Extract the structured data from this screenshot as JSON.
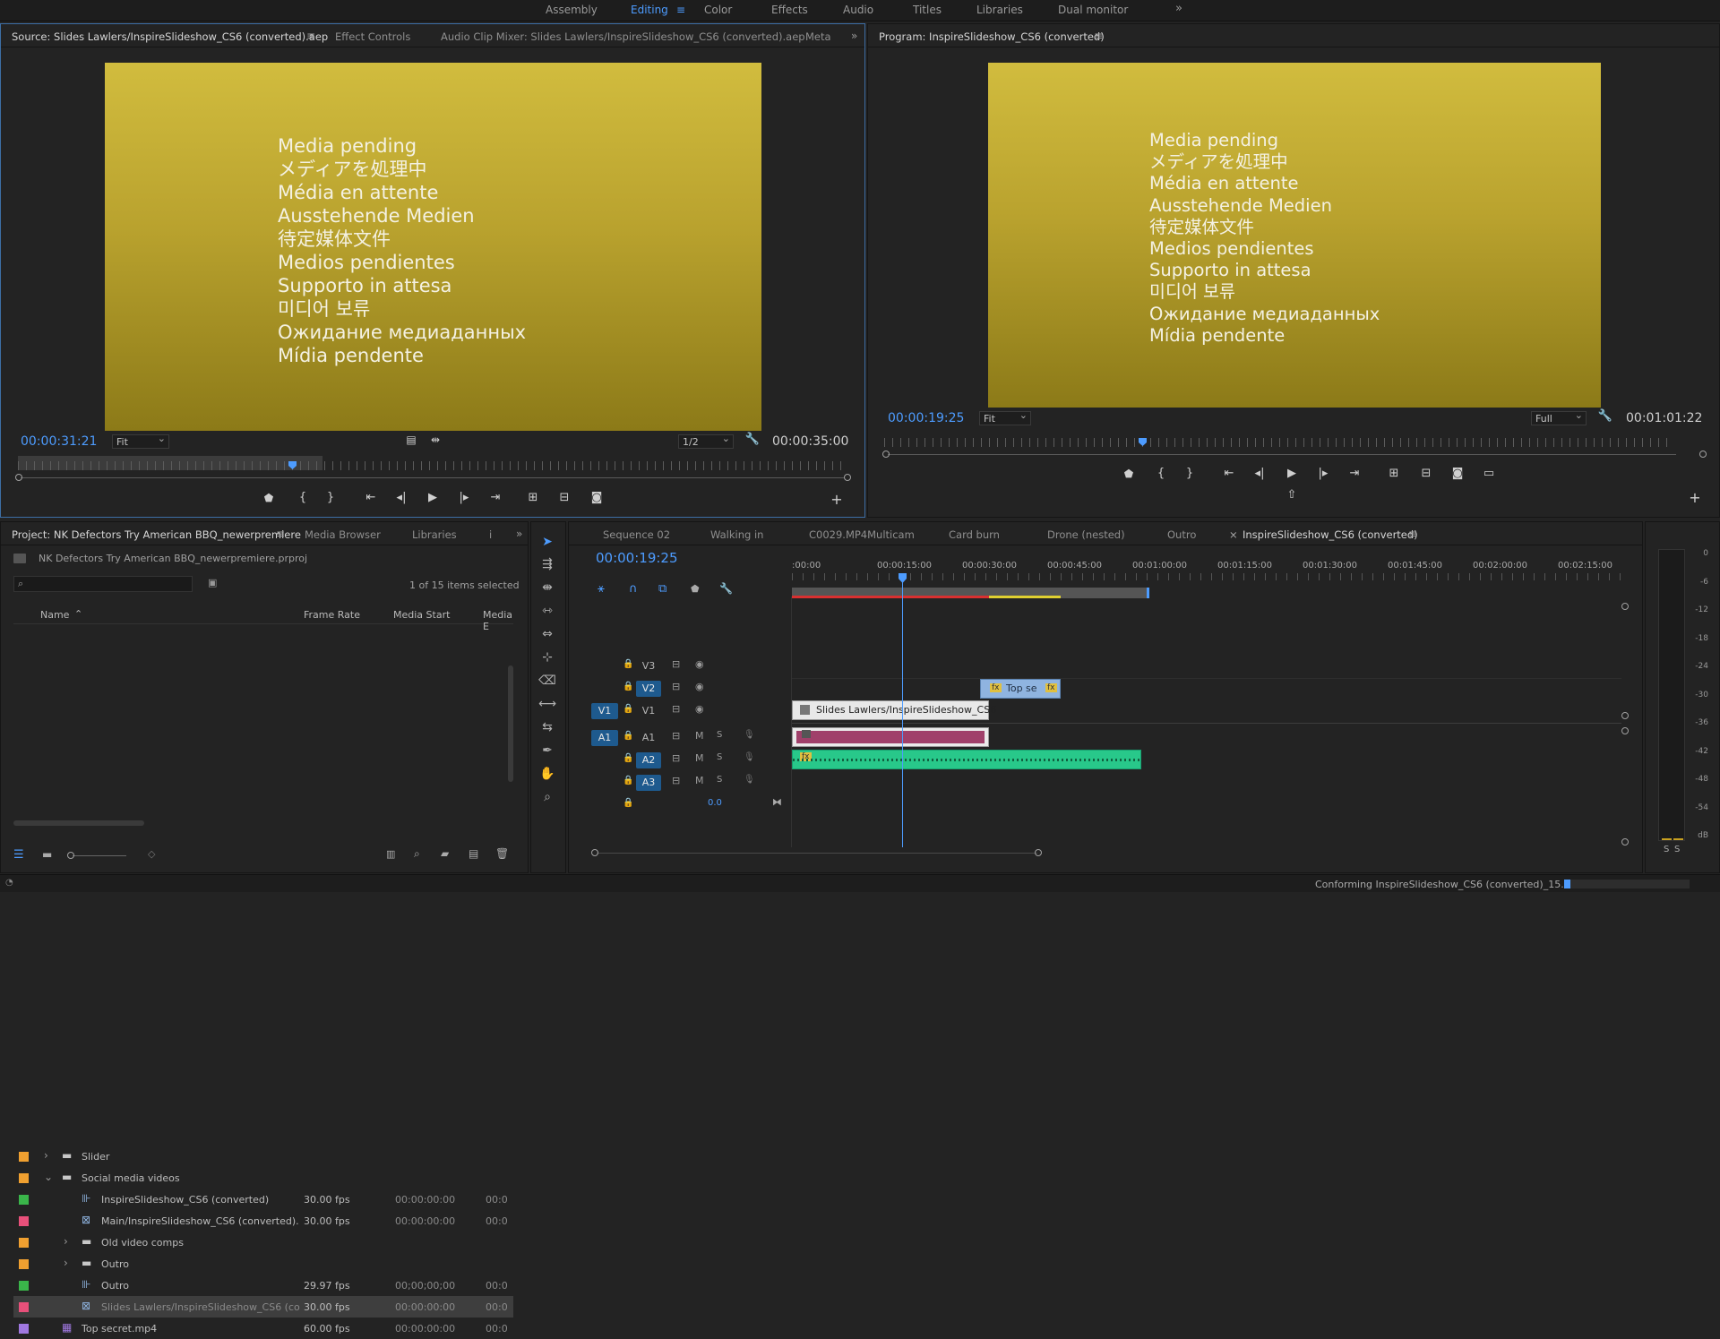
{
  "workspaces": [
    "Assembly",
    "Editing",
    "Color",
    "Effects",
    "Audio",
    "Titles",
    "Libraries",
    "Dual monitor"
  ],
  "workspace_active": "Editing",
  "source": {
    "tabs": [
      "Source: Slides Lawlers/InspireSlideshow_CS6 (converted).aep",
      "Effect Controls",
      "Audio Clip Mixer: Slides Lawlers/InspireSlideshow_CS6 (converted).aep",
      "Meta"
    ],
    "pending": [
      "Media pending",
      "メディアを処理中",
      "Média en attente",
      "Ausstehende Medien",
      "待定媒体文件",
      "Medios pendientes",
      "Supporto in attesa",
      "미디어 보류",
      "Ожидание медиаданных",
      "Mídia pendente"
    ],
    "timecode": "00:00:31:21",
    "fit": "Fit",
    "resolution": "1/2",
    "duration": "00:00:35:00"
  },
  "program": {
    "title": "Program: InspireSlideshow_CS6 (converted)",
    "pending": [
      "Media pending",
      "メディアを処理中",
      "Média en attente",
      "Ausstehende Medien",
      "待定媒体文件",
      "Medios pendientes",
      "Supporto in attesa",
      "미디어 보류",
      "Ожидание медиаданных",
      "Mídia pendente"
    ],
    "timecode": "00:00:19:25",
    "fit": "Fit",
    "resolution": "Full",
    "duration": "00:01:01:22"
  },
  "project": {
    "tabs": [
      "Project: NK Defectors Try American BBQ_newerpremiere",
      "Media Browser",
      "Libraries"
    ],
    "filename": "NK Defectors Try American BBQ_newerpremiere.prproj",
    "selection": "1 of 15 items selected",
    "columns": [
      "Name",
      "Frame Rate",
      "Media Start",
      "Media E"
    ],
    "rows": [
      {
        "name": "Slider",
        "fps": "",
        "start": "",
        "end": "",
        "color": "#f0a030",
        "type": "folder",
        "indent": 0,
        "exp": "›"
      },
      {
        "name": "Social media videos",
        "fps": "",
        "start": "",
        "end": "",
        "color": "#f0a030",
        "type": "folder",
        "indent": 0,
        "exp": "⌄"
      },
      {
        "name": "InspireSlideshow_CS6 (converted)",
        "fps": "30.00 fps",
        "start": "00:00:00:00",
        "end": "00:0",
        "color": "#3ab54a",
        "type": "seq",
        "indent": 1,
        "exp": ""
      },
      {
        "name": "Main/InspireSlideshow_CS6 (converted).",
        "fps": "30.00 fps",
        "start": "00:00:00:00",
        "end": "00:0",
        "color": "#e8507a",
        "type": "clip",
        "indent": 1,
        "exp": ""
      },
      {
        "name": "Old video comps",
        "fps": "",
        "start": "",
        "end": "",
        "color": "#f0a030",
        "type": "folder",
        "indent": 1,
        "exp": "›"
      },
      {
        "name": "Outro",
        "fps": "",
        "start": "",
        "end": "",
        "color": "#f0a030",
        "type": "folder",
        "indent": 1,
        "exp": "›"
      },
      {
        "name": "Outro",
        "fps": "29.97 fps",
        "start": "00;00;00;00",
        "end": "00:0",
        "color": "#3ab54a",
        "type": "seq",
        "indent": 1,
        "exp": ""
      },
      {
        "name": "Slides Lawlers/InspireSlideshow_CS6 (co",
        "fps": "30.00 fps",
        "start": "00:00:00:00",
        "end": "00:0",
        "color": "#e8507a",
        "type": "clip",
        "indent": 1,
        "exp": "",
        "selected": true
      },
      {
        "name": "Top secret.mp4",
        "fps": "60.00 fps",
        "start": "00:00:00:00",
        "end": "00:0",
        "color": "#a078e0",
        "type": "video",
        "indent": 0,
        "exp": ""
      }
    ]
  },
  "timeline": {
    "tabs": [
      "Sequence 02",
      "Walking in",
      "C0029.MP4Multicam",
      "Card burn",
      "Drone (nested)",
      "Outro",
      "InspireSlideshow_CS6 (converted)"
    ],
    "timecode": "00:00:19:25",
    "ruler": [
      ":00:00",
      "00:00:15:00",
      "00:00:30:00",
      "00:00:45:00",
      "00:01:00:00",
      "00:01:15:00",
      "00:01:30:00",
      "00:01:45:00",
      "00:02:00:00",
      "00:02:15:00"
    ],
    "tracks": [
      {
        "src": "",
        "tgt": "V3",
        "kind": "video"
      },
      {
        "src": "",
        "tgt": "V2",
        "kind": "video",
        "on": true
      },
      {
        "src": "V1",
        "tgt": "V1",
        "kind": "video"
      },
      {
        "src": "A1",
        "tgt": "A1",
        "kind": "audio"
      },
      {
        "src": "",
        "tgt": "A2",
        "kind": "audio",
        "on": true
      },
      {
        "src": "",
        "tgt": "A3",
        "kind": "audio",
        "on": true
      }
    ],
    "master_value": "0.0",
    "clip_v1": "Slides Lawlers/InspireSlideshow_CS6",
    "clip_v2": "Top se",
    "fx": "fx"
  },
  "meter_labels": [
    "0",
    "-6",
    "-12",
    "-18",
    "-24",
    "-30",
    "-36",
    "-42",
    "-48",
    "-54",
    "dB"
  ],
  "meter_solo": [
    "S",
    "S"
  ],
  "status": "Conforming InspireSlideshow_CS6 (converted)_15....",
  "accent": "#4d9cff"
}
